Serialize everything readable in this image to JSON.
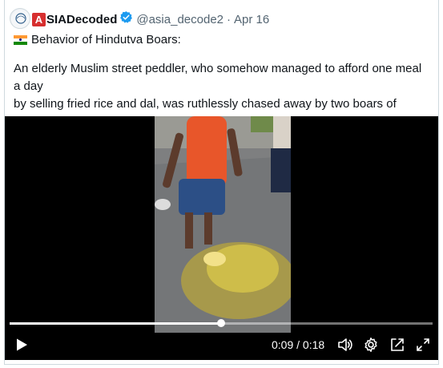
{
  "tweet": {
    "logo_letter": "A",
    "display_name": "SIADecoded",
    "handle": "@asia_decode2",
    "separator": "·",
    "date": "Apr 16",
    "title": "Behavior of Hindutva Boars:",
    "body": "An elderly Muslim street peddler, who somehow managed to afford one meal a day\nby selling fried rice and dal, was ruthlessly chased away by two boars of Hindutva\nrogues, and his foods were violently threw and spilled on the ground."
  },
  "video": {
    "current_time": "0:09",
    "time_separator": "/",
    "duration": "0:18",
    "time_display": "0:09 / 0:18",
    "progress_fraction": 0.5,
    "icons": [
      "play-icon",
      "volume-icon",
      "settings-gear-icon",
      "picture-in-picture-icon",
      "fullscreen-icon"
    ]
  },
  "colors": {
    "verified": "#1d9bf0",
    "logo_red": "#d72f2f",
    "muted_text": "#536471"
  }
}
